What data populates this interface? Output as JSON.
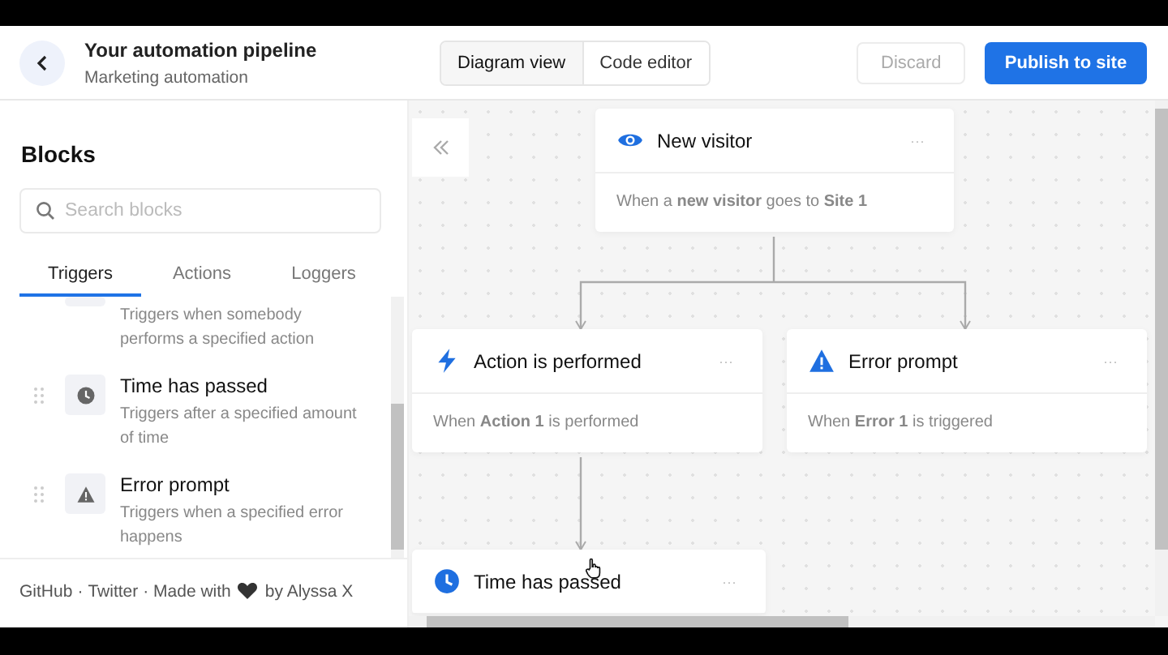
{
  "header": {
    "title": "Your automation pipeline",
    "subtitle": "Marketing automation",
    "view_tabs": [
      {
        "label": "Diagram view",
        "selected": true
      },
      {
        "label": "Code editor",
        "selected": false
      }
    ],
    "buttons": [
      {
        "label": "Discard",
        "kind": "secondary",
        "disabled": true
      },
      {
        "label": "Publish to site",
        "kind": "primary",
        "disabled": false
      }
    ]
  },
  "sidebar": {
    "heading": "Blocks",
    "search": {
      "placeholder": "Search blocks"
    },
    "tabs": [
      {
        "label": "Triggers",
        "selected": true
      },
      {
        "label": "Actions",
        "selected": false
      },
      {
        "label": "Loggers",
        "selected": false
      }
    ],
    "blocks": [
      {
        "kind": "partial",
        "description": "Triggers when somebody performs a specified action"
      },
      {
        "kind": "clock",
        "title": "Time has passed",
        "description": "Triggers after a specified amount of time"
      },
      {
        "kind": "warning",
        "title": "Error prompt",
        "description": "Triggers when a specified error happens"
      }
    ],
    "footer": {
      "links": [
        "GitHub",
        "Twitter"
      ],
      "separator": "·",
      "made_with": "· Made with",
      "author": "by Alyssa X"
    }
  },
  "canvas": {
    "nodes": [
      {
        "kind": "eye",
        "title": "New visitor",
        "menu": "···",
        "body": "When a **new visitor** goes to **Site 1**"
      },
      {
        "kind": "bolt",
        "title": "Action is performed",
        "menu": "···",
        "body": "When **Action 1** is performed"
      },
      {
        "kind": "warning",
        "title": "Error prompt",
        "menu": "···",
        "body": "When **Error 1** is triggered"
      },
      {
        "kind": "clock",
        "title": "Time has passed",
        "menu": "···"
      }
    ]
  }
}
